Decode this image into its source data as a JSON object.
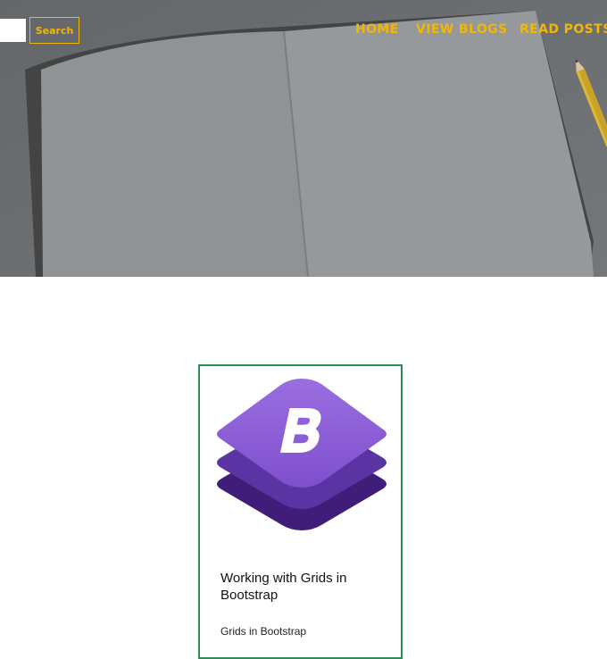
{
  "header": {
    "search": {
      "placeholder": "",
      "value": "",
      "button_label": "Search"
    },
    "nav": [
      {
        "label": "HOME"
      },
      {
        "label": "VIEW BLOGS"
      },
      {
        "label": "READ POSTS"
      }
    ]
  },
  "card": {
    "image_icon": "bootstrap-logo-icon",
    "image_letter": "B",
    "title": "Working with Grids in Bootstrap",
    "subtitle": "Grids in Bootstrap"
  },
  "colors": {
    "accent": "#f2b705",
    "card_border": "#2e8b57",
    "bootstrap_purple": "#7952b3"
  }
}
